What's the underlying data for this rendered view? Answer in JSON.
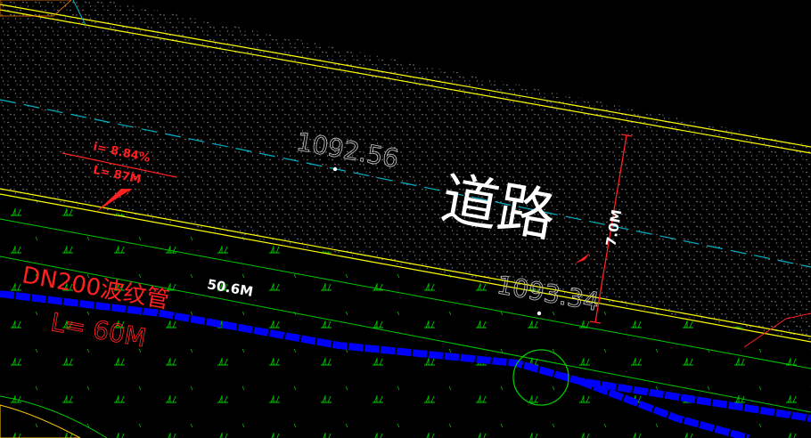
{
  "drawing": {
    "road_label": "道路",
    "elevation_top": "1092.56",
    "elevation_bottom": "1093.34",
    "slope_i": "i= 8.84%",
    "slope_L": "L= 87M",
    "width_dim": "7.0M",
    "pipe_length": "50.6M",
    "pipe_name": "DN200波纹管",
    "pipe_L": "L= 60M"
  },
  "colors": {
    "background": "#000000",
    "road_edge": "#ffff00",
    "centerline": "#00b4c8",
    "pipe": "#0000ff",
    "annotation": "#ff2020",
    "boundary": "#00c800",
    "text": "#ffffff"
  }
}
